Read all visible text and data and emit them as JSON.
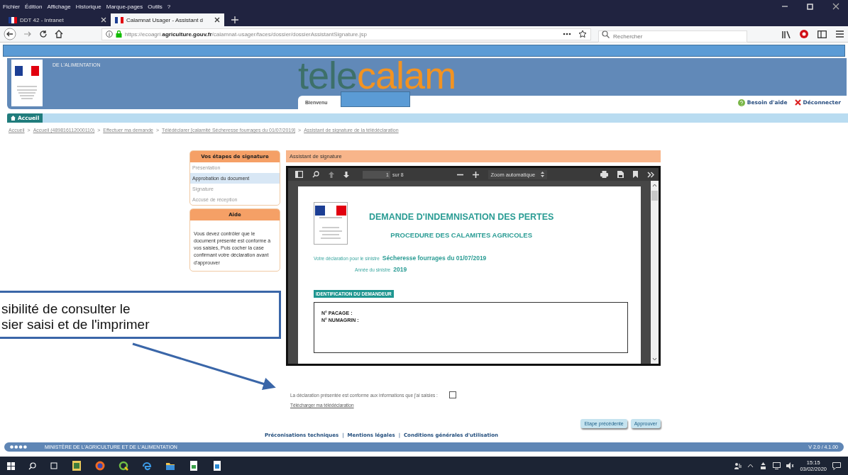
{
  "browser": {
    "menu": [
      "Fichier",
      "Édition",
      "Affichage",
      "Historique",
      "Marque-pages",
      "Outils",
      "?"
    ],
    "tabs": [
      {
        "title": "DDT 42 - Intranet",
        "selected": false
      },
      {
        "title": "Calamnat Usager - Assistant d",
        "selected": true
      }
    ],
    "url": {
      "prefix": "https://ecoagri.",
      "domain": "agriculture.gouv.fr",
      "path": "/calamnat-usager/faces/dossier/dossierAssistantSignature.jsp"
    },
    "search": {
      "placeholder": "Rechercher"
    }
  },
  "header": {
    "ministry": "DE L'ALIMENTATION",
    "logo": [
      "tele",
      "calam"
    ],
    "welcome": "Bienvenu",
    "links": [
      {
        "kind": "help",
        "label": "Besoin d'aide"
      },
      {
        "kind": "logout",
        "label": "Déconnecter"
      }
    ]
  },
  "nav": {
    "home": "Accueil"
  },
  "breadcrumb_separator": ">",
  "breadcrumb": [
    "Accueil",
    "Accueil (489816112000110)",
    "Effectuer ma demande",
    "Télédéclarer [calamité Sécheresse fourrages du 01/07/2019]",
    "Assistant de signature de la télédéclaration"
  ],
  "steps": {
    "title": "Vos étapes de signature",
    "items": [
      {
        "label": "Présentation",
        "selected": false
      },
      {
        "label": "Approbation du document",
        "selected": true
      },
      {
        "label": "Signature",
        "selected": false
      },
      {
        "label": "Accusé de réception",
        "selected": false
      }
    ]
  },
  "help": {
    "title": "Aide",
    "text": "Vous devez contrôler que le document présenté est conforme à vos saisies, Puis cocher la case confirmant votre déclaration avant d'approuver"
  },
  "signature": {
    "title": "Assistant de signature",
    "page": "1",
    "page_count": "sur 8",
    "zoom": "Zoom automatique",
    "document": {
      "title": "DEMANDE D'INDEMNISATION DES PERTES",
      "subtitle": "PROCEDURE DES CALAMITES AGRICOLES",
      "fields": [
        {
          "label": "Votre déclaration pour le sinistre",
          "value": "Sécheresse fourrages du 01/07/2019"
        },
        {
          "label": "Année du sinistre",
          "value": "2019"
        }
      ],
      "section": "IDENTIFICATION DU DEMANDEUR",
      "rows": [
        "N° PACAGE :",
        "N° NUMAGRIN :"
      ]
    }
  },
  "confirm": {
    "text": "La déclaration présentée est conforme aux informations que j'ai saisies :",
    "checked": false
  },
  "download": "Télécharger ma télédéclaration",
  "buttons": [
    "Etape précédente",
    "Approuver"
  ],
  "footer_separator": "|",
  "footer": [
    "Préconisations techniques",
    "Mentions légales",
    "Conditions générales d'utilisation"
  ],
  "status_bar": {
    "ministry": "MINISTÈRE DE L'AGRICULTURE ET DE L'ALIMENTATION",
    "version": "V 2.0 / 4.1.00"
  },
  "taskbar": {
    "time": "15:15",
    "date": "03/02/2020"
  },
  "callout": {
    "lines": [
      "sibilité de consulter le",
      "sier saisi et de l'imprimer"
    ]
  }
}
